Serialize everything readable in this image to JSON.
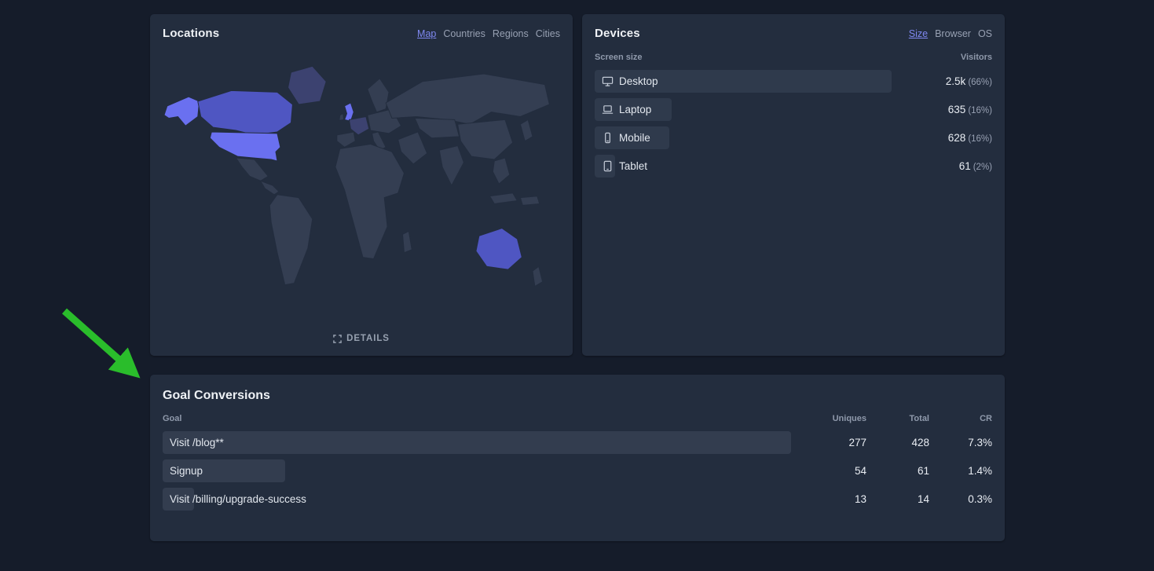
{
  "theme": {
    "accent": "#7f88f0",
    "arrow_color": "#2abd2b",
    "map": {
      "base": "#343e52",
      "highlight": "#6a70f0",
      "medium": "#4f56c2",
      "soft": "#3c4270"
    }
  },
  "locations": {
    "title": "Locations",
    "tabs": [
      {
        "label": "Map",
        "active": true
      },
      {
        "label": "Countries",
        "active": false
      },
      {
        "label": "Regions",
        "active": false
      },
      {
        "label": "Cities",
        "active": false
      }
    ],
    "details_label": "DETAILS"
  },
  "devices": {
    "title": "Devices",
    "tabs": [
      {
        "label": "Size",
        "active": true
      },
      {
        "label": "Browser",
        "active": false
      },
      {
        "label": "OS",
        "active": false
      }
    ],
    "columns": {
      "name": "Screen size",
      "visitors": "Visitors"
    },
    "rows": [
      {
        "icon": "desktop-icon",
        "label": "Desktop",
        "value": "2.5k",
        "share": "(66%)",
        "bar": 100
      },
      {
        "icon": "laptop-icon",
        "label": "Laptop",
        "value": "635",
        "share": "(16%)",
        "bar": 26
      },
      {
        "icon": "mobile-icon",
        "label": "Mobile",
        "value": "628",
        "share": "(16%)",
        "bar": 25
      },
      {
        "icon": "tablet-icon",
        "label": "Tablet",
        "value": "61",
        "share": "(2%)",
        "bar": 7
      }
    ]
  },
  "goals": {
    "title": "Goal Conversions",
    "columns": {
      "goal": "Goal",
      "uniques": "Uniques",
      "total": "Total",
      "cr": "CR"
    },
    "rows": [
      {
        "label": "Visit /blog**",
        "uniques": "277",
        "total": "428",
        "cr": "7.3%",
        "bar": 100
      },
      {
        "label": "Signup",
        "uniques": "54",
        "total": "61",
        "cr": "1.4%",
        "bar": 19.5
      },
      {
        "label": "Visit /billing/upgrade-success",
        "uniques": "13",
        "total": "14",
        "cr": "0.3%",
        "bar": 5
      }
    ]
  }
}
